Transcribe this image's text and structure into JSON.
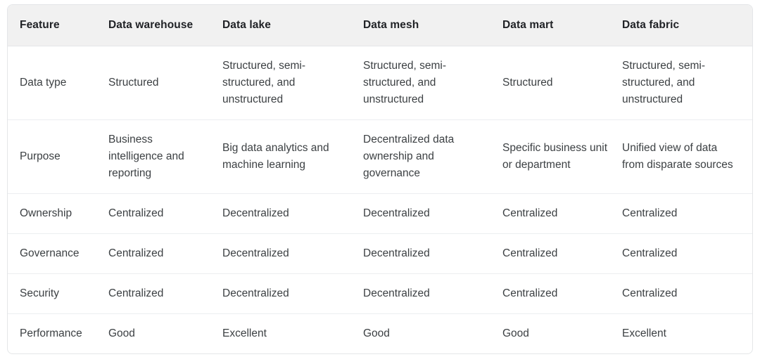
{
  "table": {
    "columns": [
      "Feature",
      "Data warehouse",
      "Data lake",
      "Data mesh",
      "Data mart",
      "Data fabric"
    ],
    "rows": [
      {
        "feature": "Data type",
        "cells": [
          "Data type",
          "Structured",
          "Structured, semi-structured, and unstructured",
          "Structured, semi-structured, and unstructured",
          "Structured",
          "Structured, semi-structured, and unstructured"
        ]
      },
      {
        "feature": "Purpose",
        "cells": [
          "Purpose",
          "Business intelligence and reporting",
          "Big data analytics and machine learning",
          "Decentralized data ownership and governance",
          "Specific business unit or department",
          "Unified view of data from disparate sources"
        ]
      },
      {
        "feature": "Ownership",
        "cells": [
          "Ownership",
          "Centralized",
          "Decentralized",
          "Decentralized",
          "Centralized",
          "Centralized"
        ]
      },
      {
        "feature": "Governance",
        "cells": [
          "Governance",
          "Centralized",
          "Decentralized",
          "Decentralized",
          "Centralized",
          "Centralized"
        ]
      },
      {
        "feature": "Security",
        "cells": [
          "Security",
          "Centralized",
          "Decentralized",
          "Decentralized",
          "Centralized",
          "Centralized"
        ]
      },
      {
        "feature": "Performance",
        "cells": [
          "Performance",
          "Good",
          "Excellent",
          "Good",
          "Good",
          "Excellent"
        ]
      }
    ]
  },
  "colors": {
    "header_background": "#f1f1f1",
    "header_text": "#1f2125",
    "body_text": "#3c4043",
    "border": "#e4e6e8",
    "row_divider": "#eceef0",
    "page_background": "#ffffff"
  }
}
